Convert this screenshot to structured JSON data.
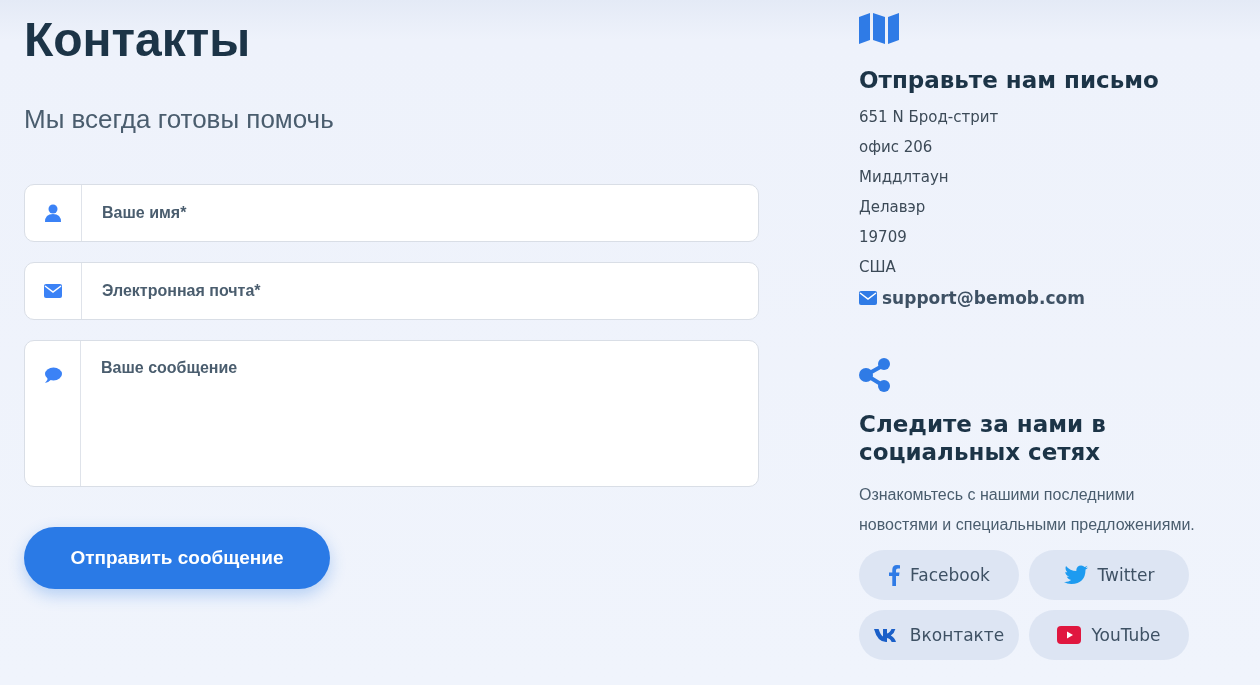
{
  "contact": {
    "title": "Контакты",
    "subtitle": "Мы всегда готовы помочь",
    "fields": [
      {
        "kind": "person",
        "placeholder": "Ваше имя*"
      },
      {
        "kind": "email",
        "placeholder": "Электронная почта*"
      },
      {
        "kind": "message",
        "placeholder": "Ваше сообщение"
      }
    ],
    "submit": "Отправить сообщение"
  },
  "mail": {
    "title": "Отправьте нам письмо",
    "address": [
      "651 N Брод-стрит",
      "офис 206",
      "Миддлтаун",
      "Делавэр",
      "19709",
      "США"
    ],
    "email": "support@bemob.com"
  },
  "social": {
    "title": "Следите за нами в социальных сетях",
    "text": "Ознакомьтесь с нашими последними\nновостями и специальными предложениями.",
    "links": [
      {
        "kind": "facebook",
        "label": "Facebook"
      },
      {
        "kind": "twitter",
        "label": "Twitter"
      },
      {
        "kind": "vk",
        "label": "Вконтакте"
      },
      {
        "kind": "youtube",
        "label": "YouTube"
      }
    ]
  }
}
